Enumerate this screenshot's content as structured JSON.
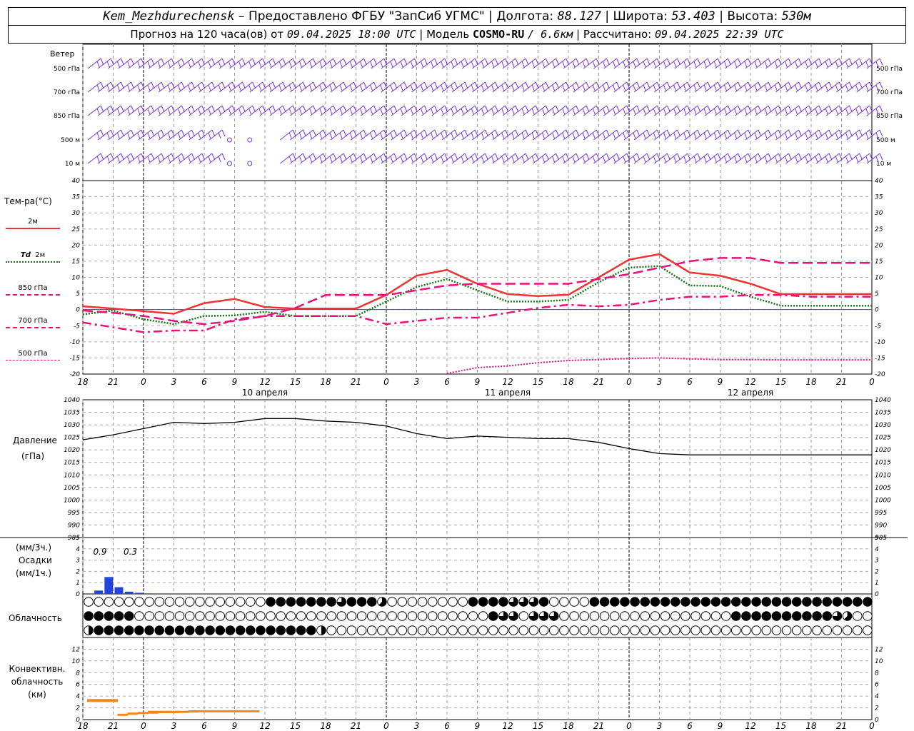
{
  "header": {
    "station": "Kem_Mezhdurechensk",
    "provider_label": "– Предоставлено ФГБУ \"ЗапСиб УГМС\"",
    "lon_label": "Долгота:",
    "lon": "88.127",
    "lat_label": "Широта:",
    "lat": "53.403",
    "alt_label": "Высота:",
    "alt": "530м",
    "forecast_label": "Прогноз на 120 часа(ов) от",
    "forecast_from": "09.04.2025 18:00 UTC",
    "model_label": "Модель",
    "model": "COSMO-RU",
    "resolution": "/ 6.6км",
    "calc_label": "Рассчитано:",
    "calc_time": "09.04.2025 22:39 UTC"
  },
  "labels": {
    "wind": "Ветер",
    "wind_levels": [
      "500 гПа",
      "700 гПа",
      "850 гПа",
      "500 м",
      "10 м"
    ],
    "temp_title": "Тем-ра(°С)",
    "legend_2m": "2м",
    "legend_td": "Td",
    "legend_td_suffix": "2м",
    "legend_850": "850 гПа",
    "legend_700": "700 гПа",
    "legend_500": "500 гПа",
    "pressure_title": "Давление",
    "pressure_unit": "(гПа)",
    "precip_unit3": "(мм/3ч.)",
    "precip_title": "Осадки",
    "precip_unit1": "(мм/1ч.)",
    "cloud_title": "Облачность",
    "conv_title": "Конвективн. облачность (км)"
  },
  "time_axis": {
    "hour_labels": [
      "18",
      "21",
      "0",
      "3",
      "6",
      "9",
      "12",
      "15",
      "18",
      "21",
      "0",
      "3",
      "6",
      "9",
      "12",
      "15",
      "18",
      "21",
      "0",
      "3",
      "6",
      "9",
      "12",
      "15",
      "18",
      "21",
      "0"
    ],
    "day_labels": [
      "10 апреля",
      "11 апреля",
      "12 апреля"
    ]
  },
  "chart_data": [
    {
      "type": "line",
      "panel": "temperature",
      "ylabel": "Тем-ра(°С)",
      "ylim": [
        -20,
        40
      ],
      "yticks": [
        -20,
        -15,
        -10,
        -5,
        0,
        5,
        10,
        15,
        20,
        25,
        30,
        35,
        40
      ],
      "x_hours": [
        0,
        3,
        6,
        9,
        12,
        15,
        18,
        21,
        24,
        27,
        30,
        33,
        36,
        39,
        42,
        45,
        48,
        51,
        54,
        57,
        60,
        63,
        66,
        69,
        72,
        75,
        78
      ],
      "series": [
        {
          "name": "2м",
          "color": "#ee3333",
          "style": "solid",
          "values": [
            1,
            0.3,
            -0.5,
            -1.3,
            2,
            3.3,
            0.8,
            0.3,
            0.3,
            0.3,
            4.5,
            10.5,
            12.3,
            8,
            4.8,
            4.2,
            4.6,
            10,
            15.5,
            17.2,
            11.5,
            10.5,
            8,
            4.8,
            4.8,
            4.8,
            4.8
          ]
        },
        {
          "name": "Td 2м",
          "color": "#117711",
          "style": "dotted",
          "values": [
            -1.5,
            -0.3,
            -3,
            -4.5,
            -2,
            -1.8,
            -0.7,
            -2,
            -2,
            -2,
            2.5,
            7,
            9.5,
            6,
            2.5,
            2.5,
            3,
            8.5,
            13,
            13.5,
            7.5,
            7.3,
            4,
            1.2,
            1.2,
            1.2,
            1.2
          ]
        },
        {
          "name": "850 гПа",
          "color": "#e8117a",
          "style": "longdash",
          "values": [
            -0.3,
            -1,
            -2,
            -3.5,
            -4.5,
            -3.5,
            -2,
            0.5,
            4.5,
            4.5,
            4.5,
            6,
            7.5,
            8,
            8,
            8,
            8,
            9.5,
            11,
            13,
            15,
            16,
            16,
            14.5,
            14.5,
            14.5,
            14.5
          ]
        },
        {
          "name": "700 гПа",
          "color": "#e8117a",
          "style": "dashdot",
          "values": [
            -4,
            -5.5,
            -7,
            -6.5,
            -6.5,
            -3,
            -2,
            -2,
            -2,
            -2,
            -4.5,
            -3.5,
            -2.5,
            -2.5,
            -1,
            0.5,
            1.5,
            1,
            1.5,
            3,
            4,
            4,
            4.5,
            4.5,
            4,
            4,
            4
          ]
        },
        {
          "name": "500 гПа",
          "color": "#e8117a",
          "style": "dotted",
          "values": [
            null,
            null,
            null,
            null,
            null,
            null,
            null,
            null,
            null,
            null,
            null,
            null,
            -19.8,
            -18,
            -17.5,
            -16.5,
            -15.8,
            -15.5,
            -15.2,
            -15,
            -15.3,
            -15.5,
            -15.5,
            -15.6,
            -15.6,
            -15.6,
            -15.6
          ]
        }
      ]
    },
    {
      "type": "line",
      "panel": "pressure",
      "ylabel": "Давление (гПа)",
      "ylim": [
        985,
        1040
      ],
      "yticks": [
        985,
        990,
        995,
        1000,
        1005,
        1010,
        1015,
        1020,
        1025,
        1030,
        1035,
        1040
      ],
      "x_hours": [
        0,
        3,
        6,
        9,
        12,
        15,
        18,
        21,
        24,
        27,
        30,
        33,
        36,
        39,
        42,
        45,
        48,
        51,
        54,
        57,
        60,
        63,
        66,
        69,
        72,
        75,
        78
      ],
      "series": [
        {
          "name": "",
          "color": "#000000",
          "values": [
            1024,
            1026,
            1028.5,
            1031,
            1030.5,
            1031,
            1032.5,
            1032.5,
            1031.5,
            1031,
            1029.5,
            1026.5,
            1024.5,
            1025.5,
            1025,
            1024.5,
            1024.5,
            1023,
            1020.5,
            1018.5,
            1018,
            1018,
            1018,
            1018,
            1018,
            1018,
            1018
          ]
        }
      ]
    },
    {
      "type": "bar",
      "panel": "precipitation",
      "ylabel": "Осадки (мм/1ч.)",
      "ylim": [
        0,
        5
      ],
      "x_hours": [
        0,
        1,
        2,
        3,
        4,
        5,
        6
      ],
      "values": [
        0,
        0.3,
        1.5,
        0.6,
        0.2,
        0.1,
        0.05
      ],
      "three_hour_totals": [
        "0.9",
        "0.3"
      ]
    },
    {
      "type": "bar",
      "panel": "convective_cloud",
      "ylabel": "Конвективн. облачность (км)",
      "ylim": [
        0,
        14
      ],
      "x_hours": [
        0,
        1,
        2,
        3,
        4,
        5,
        6,
        7,
        8,
        9,
        10,
        11,
        12,
        13,
        14,
        15,
        16
      ],
      "tops_km": [
        3.5,
        3.5,
        3.5,
        1,
        1.2,
        1.3,
        1.5,
        1.5,
        1.5,
        1.5,
        1.6,
        1.6,
        1.6,
        1.6,
        1.6,
        1.6,
        1.6
      ],
      "bases_km": [
        3,
        3,
        3,
        0.9,
        0.9,
        1,
        1,
        1.1,
        1.1,
        1.2,
        1.2,
        1.3,
        1.3,
        1.3,
        1.3,
        1.3,
        1.3
      ]
    }
  ],
  "wind": {
    "color": "#7a33dd",
    "levels": [
      "500 гПа",
      "700 гПа",
      "850 гПа",
      "500 м",
      "10 м"
    ]
  },
  "cloud_cover": {
    "rows": [
      "upper",
      "middle",
      "lower"
    ],
    "upper": "000000000000000000888888868885000000008888666800008888888888888888888888888888880000000000000000000000000000",
    "middle": "888880000000000000000000000000000000000086606660000000000000000088888888886500000000000000000000000000000000",
    "lower": "488888888888888888888884000000000000000000000000000000000000000000000000000000000000000000000000000000000000"
  }
}
